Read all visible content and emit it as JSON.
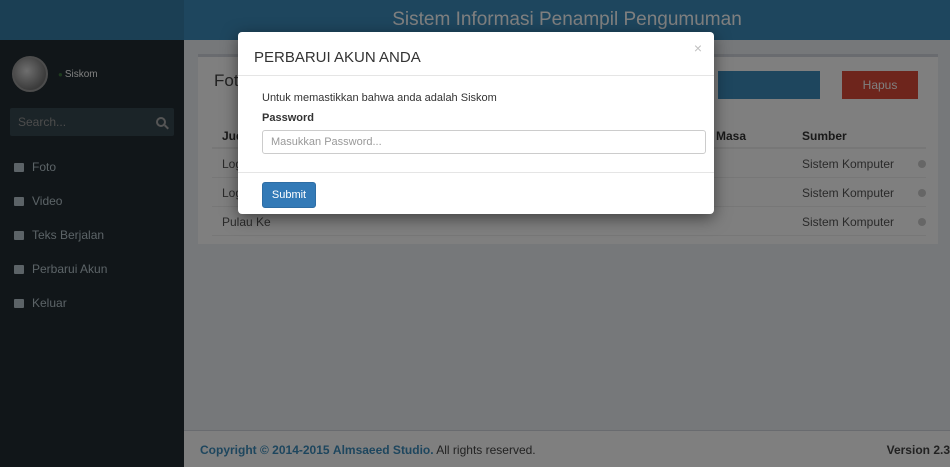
{
  "header": {
    "app_title": "Sistem Informasi Penampil Pengumuman"
  },
  "user": {
    "name": "Siskom"
  },
  "sidebar": {
    "search_placeholder": "Search...",
    "items": [
      {
        "label": "Foto",
        "icon": "folder-icon"
      },
      {
        "label": "Video",
        "icon": "folder-icon"
      },
      {
        "label": "Teks Berjalan",
        "icon": "folder-icon"
      },
      {
        "label": "Perbarui Akun",
        "icon": "folder-icon"
      },
      {
        "label": "Keluar",
        "icon": "folder-icon"
      }
    ]
  },
  "content": {
    "box_title": "Foto",
    "delete_button": "Hapus",
    "table": {
      "headers": [
        "Judul",
        "Masa",
        "Sumber"
      ],
      "rows": [
        {
          "title": "Logo Un",
          "source": "Sistem Komputer"
        },
        {
          "title": "Logo Pri",
          "source": "Sistem Komputer"
        },
        {
          "title": "Pulau Ke",
          "source": "Sistem Komputer"
        }
      ]
    }
  },
  "footer": {
    "copyright_prefix": "Copyright © 2014-2015",
    "company": "Almsaeed Studio.",
    "rights": "All rights reserved.",
    "version": "Version 2.3"
  },
  "modal": {
    "title": "PERBARUI AKUN ANDA",
    "close_symbol": "×",
    "description": "Untuk memastikkan bahwa anda adalah Siskom",
    "password_label": "Password",
    "password_placeholder": "Masukkan Password...",
    "password_value": "",
    "submit_label": "Submit"
  },
  "colors": {
    "header": "#3c8dbc",
    "sidebar": "#222d32",
    "danger": "#dd4b39",
    "primary_button": "#337ab7"
  }
}
